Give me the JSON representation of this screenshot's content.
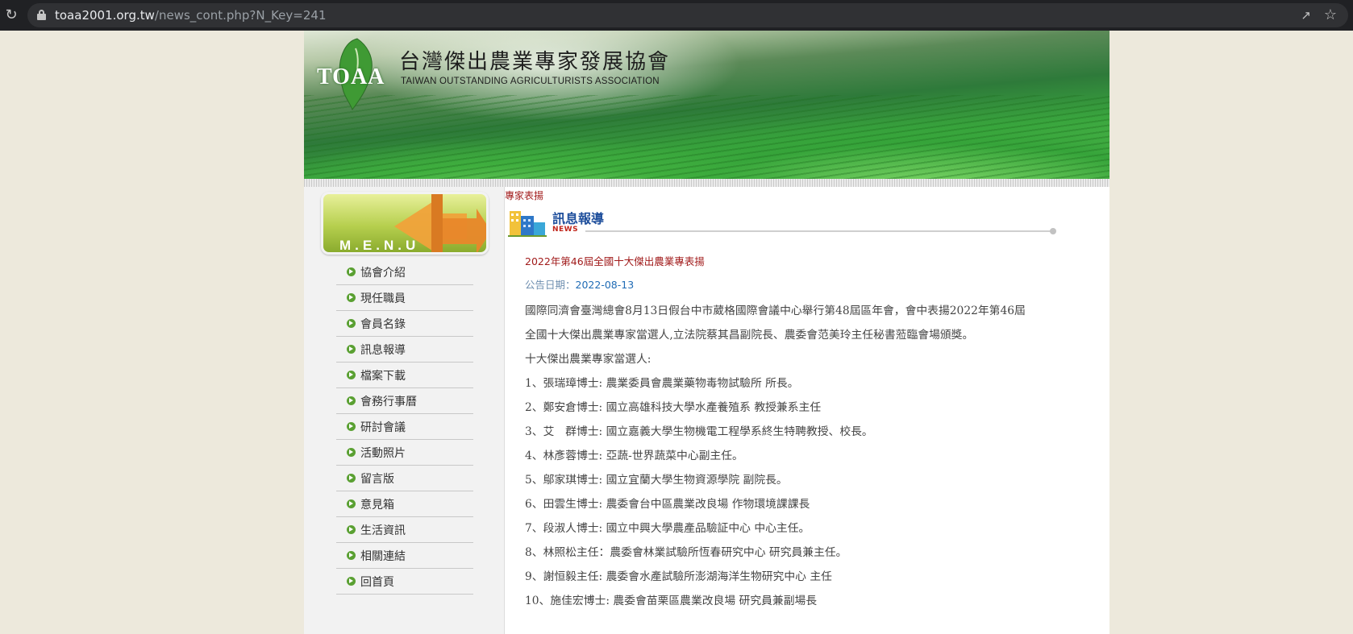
{
  "browser": {
    "url_host": "toaa2001.org.tw",
    "url_path": "/news_cont.php?N_Key=241"
  },
  "header": {
    "logo_mark": "TOAA",
    "title_cn": "台灣傑出農業專家發展協會",
    "title_en": "TAIWAN OUTSTANDING AGRICULTURISTS ASSOCIATION"
  },
  "sidebar": {
    "menu_title": "M.E.N.U",
    "items": [
      {
        "label": "協會介紹"
      },
      {
        "label": "現任職員"
      },
      {
        "label": "會員名錄"
      },
      {
        "label": "訊息報導"
      },
      {
        "label": "檔案下載"
      },
      {
        "label": "會務行事曆"
      },
      {
        "label": "研討會議"
      },
      {
        "label": "活動照片"
      },
      {
        "label": "留言版"
      },
      {
        "label": "意見箱"
      },
      {
        "label": "生活資訊"
      },
      {
        "label": "相關連結"
      },
      {
        "label": "回首頁"
      }
    ]
  },
  "main": {
    "breadcrumb": "專家表揚",
    "section_title": "訊息報導",
    "section_subtitle": "NEWS",
    "article_title": "2022年第46屆全國十大傑出農業專表揚",
    "date_label": "公告日期：",
    "date_value": "2022-08-13",
    "lines": [
      "國際同濟會臺灣總會8月13日假台中市葳格國際會議中心舉行第48屆區年會，會中表揚2022年第46屆",
      "全國十大傑出農業專家當選人,立法院蔡其昌副院長、農委會范美玲主任秘書蒞臨會場頒獎。",
      "十大傑出農業專家當選人:",
      "1、張瑞璋博士: 農業委員會農業藥物毒物試驗所 所長。",
      "2、鄭安倉博士: 國立高雄科技大學水產養殖系 教授兼系主任",
      "3、艾　群博士: 國立嘉義大學生物機電工程學系終生特聘教授、校長。",
      "4、林彥蓉博士: 亞蔬-世界蔬菜中心副主任。",
      "5、鄔家琪博士: 國立宜蘭大學生物資源學院 副院長。",
      "6、田雲生博士: 農委會台中區農業改良場 作物環境課課長",
      "7、段淑人博士: 國立中興大學農產品驗証中心 中心主任。",
      "8、林照松主任：農委會林業試驗所恆春研究中心 研究員兼主任。",
      "9、謝恒毅主任: 農委會水產試驗所澎湖海洋生物研究中心 主任",
      "10、施佳宏博士: 農委會苗栗區農業改良場 研究員兼副場長"
    ]
  }
}
